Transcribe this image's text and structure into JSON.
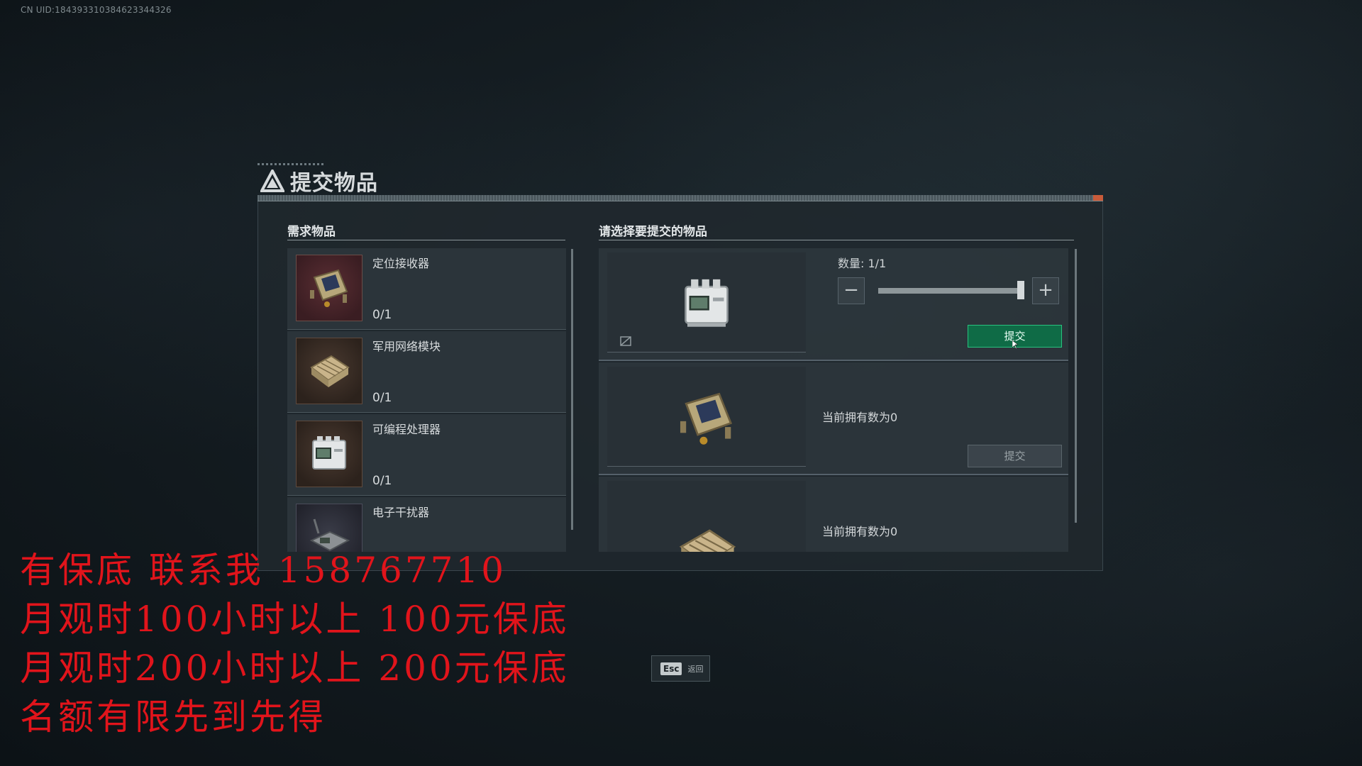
{
  "uid_text": "CN UID:184393310384623344326",
  "dialog": {
    "title": "提交物品",
    "required_header": "需求物品",
    "select_header": "请选择要提交的物品"
  },
  "required_items": [
    {
      "name": "定位接收器",
      "count": "0/1",
      "icon": "gps-receiver-icon"
    },
    {
      "name": "军用网络模块",
      "count": "0/1",
      "icon": "network-module-icon"
    },
    {
      "name": "可编程处理器",
      "count": "0/1",
      "icon": "programmable-processor-icon"
    },
    {
      "name": "电子干扰器",
      "count": "",
      "icon": "electronic-jammer-icon"
    }
  ],
  "submit_items": [
    {
      "icon": "programmable-processor-icon",
      "quantity_label": "数量: 1/1",
      "quantity_fraction": 1.0,
      "submit_label": "提交",
      "state": "active"
    },
    {
      "icon": "gps-receiver-icon",
      "owned_label": "当前拥有数为0",
      "submit_label": "提交",
      "state": "inactive"
    },
    {
      "icon": "network-module-icon",
      "owned_label": "当前拥有数为0"
    }
  ],
  "colors": {
    "submit_active": "#0f6b46",
    "submit_border": "#29c27f",
    "promo_red": "#e1141b",
    "accent_orange": "#c95b3a"
  },
  "esc": {
    "key": "Esc",
    "label": "返回"
  },
  "promo_lines": [
    "有保底 联系我 158767710",
    "月观时100小时以上 100元保底",
    "月观时200小时以上 200元保底",
    "名额有限先到先得"
  ]
}
